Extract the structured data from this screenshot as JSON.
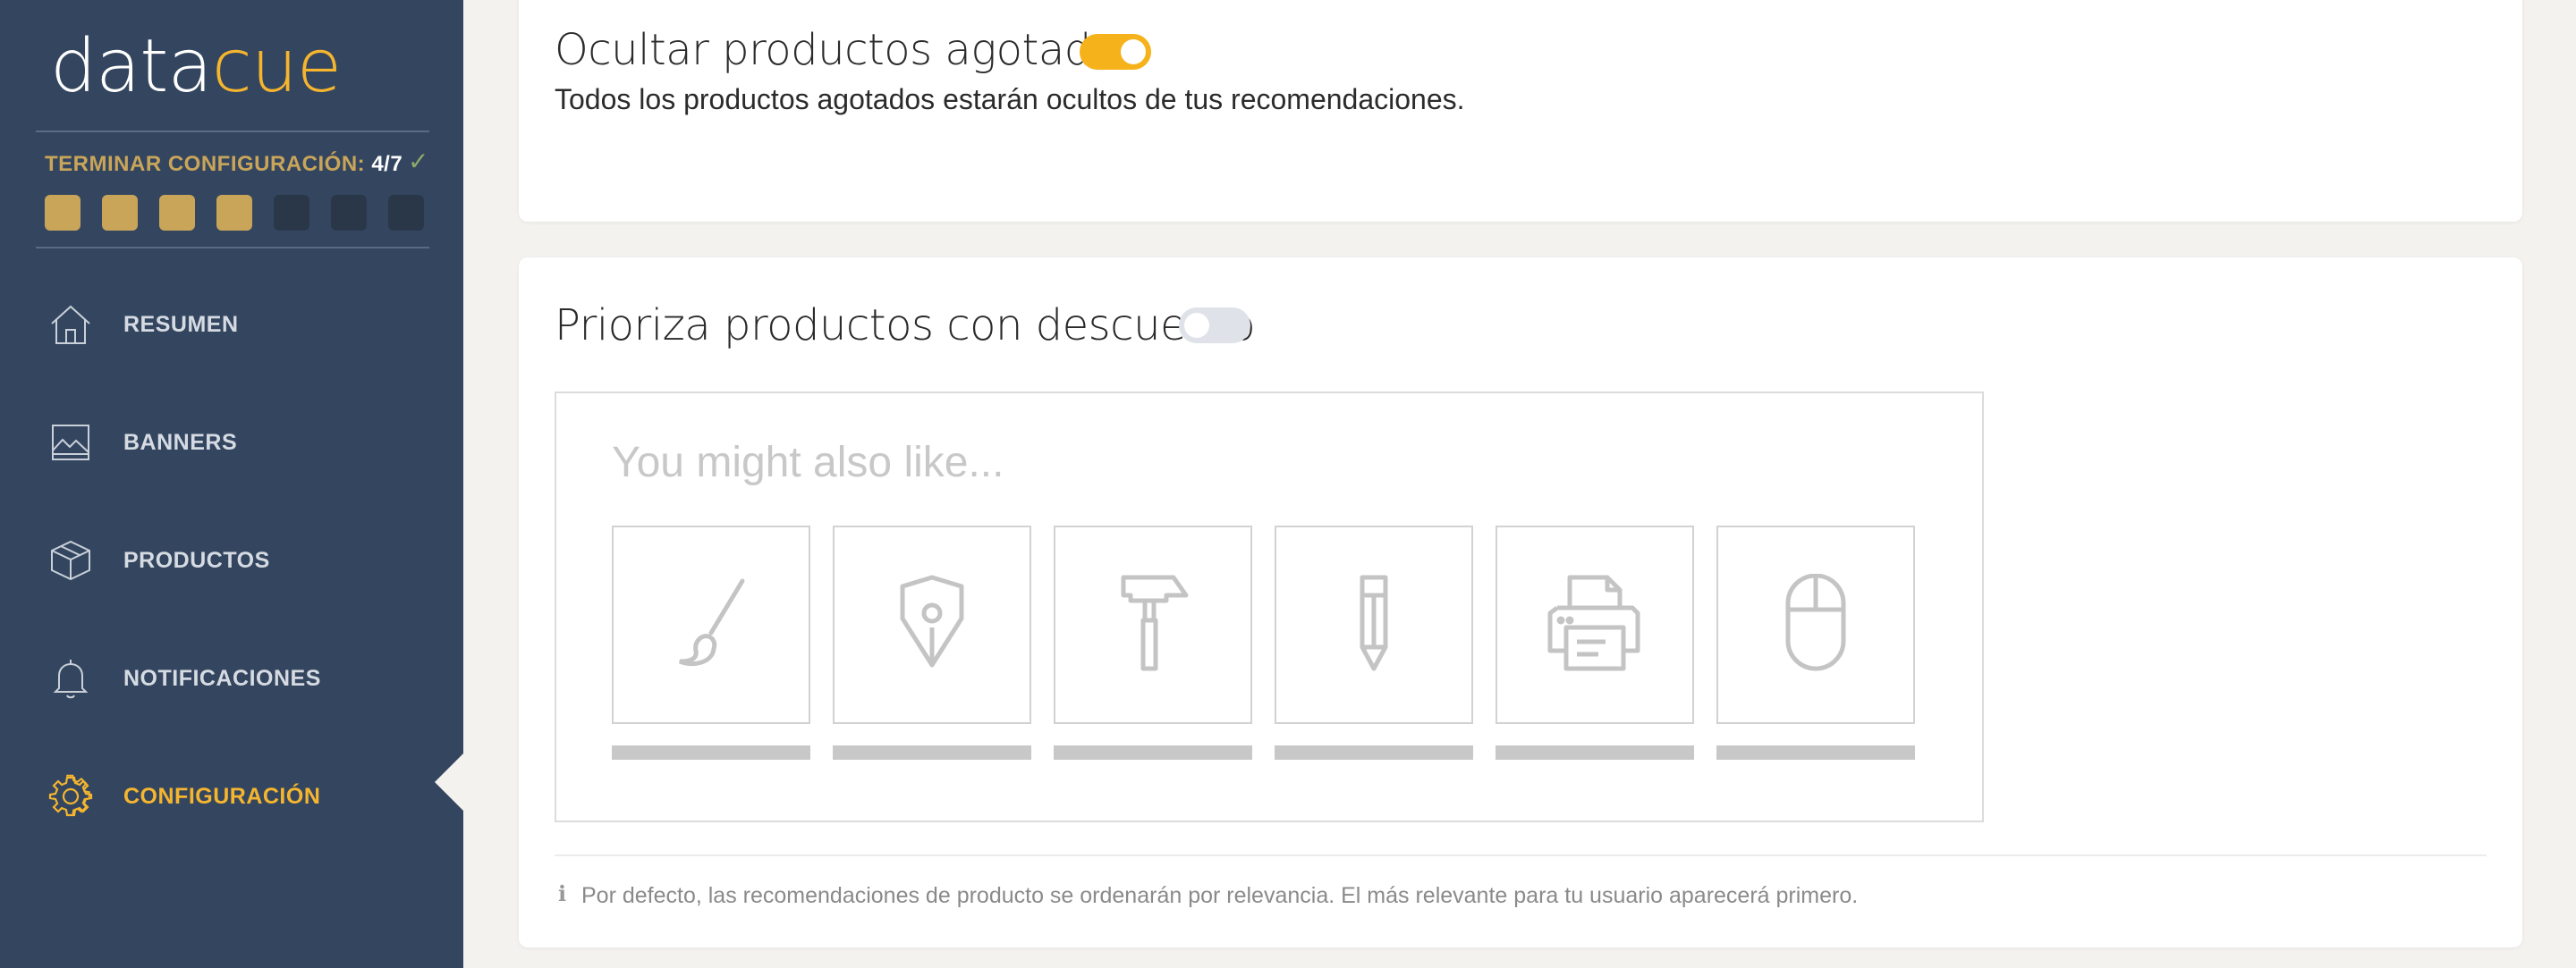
{
  "brand": {
    "part1": "data",
    "part2": "cue"
  },
  "setup": {
    "label": "TERMINAR CONFIGURACIÓN:",
    "count": "4/7",
    "check": "✓",
    "steps": [
      true,
      true,
      true,
      true,
      false,
      false,
      false
    ]
  },
  "nav": {
    "items": [
      {
        "label": "RESUMEN",
        "icon": "home-icon",
        "active": false
      },
      {
        "label": "BANNERS",
        "icon": "image-icon",
        "active": false
      },
      {
        "label": "PRODUCTOS",
        "icon": "box-icon",
        "active": false
      },
      {
        "label": "NOTIFICACIONES",
        "icon": "bell-icon",
        "active": false
      },
      {
        "label": "CONFIGURACIÓN",
        "icon": "gear-icon",
        "active": true
      }
    ]
  },
  "hide_out_of_stock": {
    "title": "Ocultar productos agotados",
    "enabled": true,
    "description": "Todos los productos agotados estarán ocultos de tus recomendaciones."
  },
  "prioritize_discounts": {
    "title": "Prioriza productos con descuento",
    "enabled": false,
    "preview_title": "You might also like...",
    "preview_icons": [
      "paintbrush-icon",
      "pen-nib-icon",
      "hammer-icon",
      "pencil-icon",
      "printer-icon",
      "mouse-icon"
    ],
    "info_icon": "ℹ",
    "info_text": "Por defecto, las recomendaciones de producto se ordenarán por relevancia. El más relevante para tu usuario aparecerá primero."
  },
  "colors": {
    "sidebar_bg": "#34465f",
    "accent": "#f5b52e",
    "step_done": "#c9a55a",
    "page_bg": "#f3f2ef"
  }
}
